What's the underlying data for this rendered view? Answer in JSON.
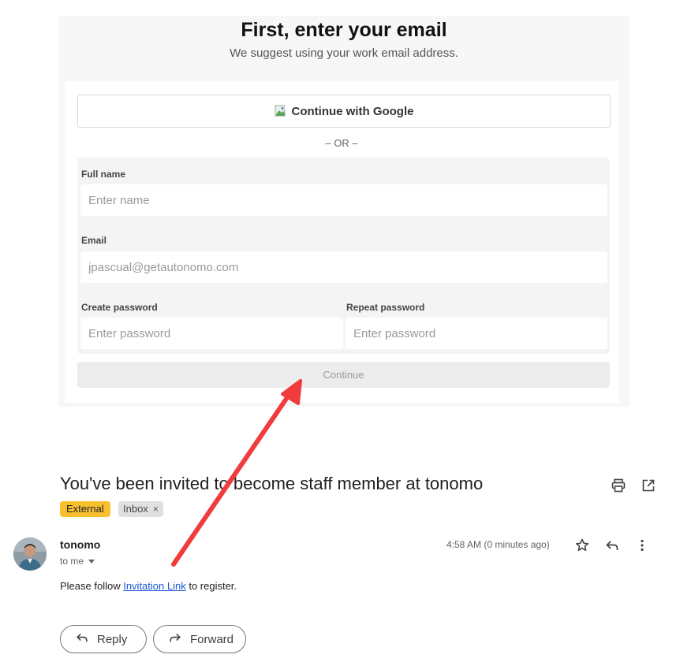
{
  "signup": {
    "title": "First, enter your email",
    "subtitle": "We suggest using your work email address.",
    "google_button": "Continue with Google",
    "or_divider": "– OR –",
    "full_name": {
      "label": "Full name",
      "placeholder": "Enter name"
    },
    "email": {
      "label": "Email",
      "placeholder": "jpascual@getautonomo.com"
    },
    "create_password": {
      "label": "Create password",
      "placeholder": "Enter password"
    },
    "repeat_password": {
      "label": "Repeat password",
      "placeholder": "Enter password"
    },
    "continue_button": "Continue"
  },
  "email": {
    "subject": "You've been invited to become staff member at tonomo",
    "labels": {
      "external": "External",
      "inbox": "Inbox",
      "inbox_remove": "×"
    },
    "sender": "tonomo",
    "recipient": "to me",
    "timestamp": "4:58 AM (0 minutes ago)",
    "body_prefix": "Please follow ",
    "body_link": "Invitation Link",
    "body_suffix": " to register.",
    "reply_button": "Reply",
    "forward_button": "Forward"
  },
  "icons": {
    "print": "printer-icon",
    "open_new_window": "open-in-new-window-icon",
    "star": "star-icon",
    "reply": "reply-icon",
    "more": "more-vertical-icon",
    "chevron": "chevron-down-icon",
    "forward": "forward-icon",
    "google_logo": "broken-image-icon"
  },
  "colors": {
    "annotation_arrow": "#f03c3c",
    "external_chip": "#f8c02f",
    "link": "#1a55d6"
  }
}
